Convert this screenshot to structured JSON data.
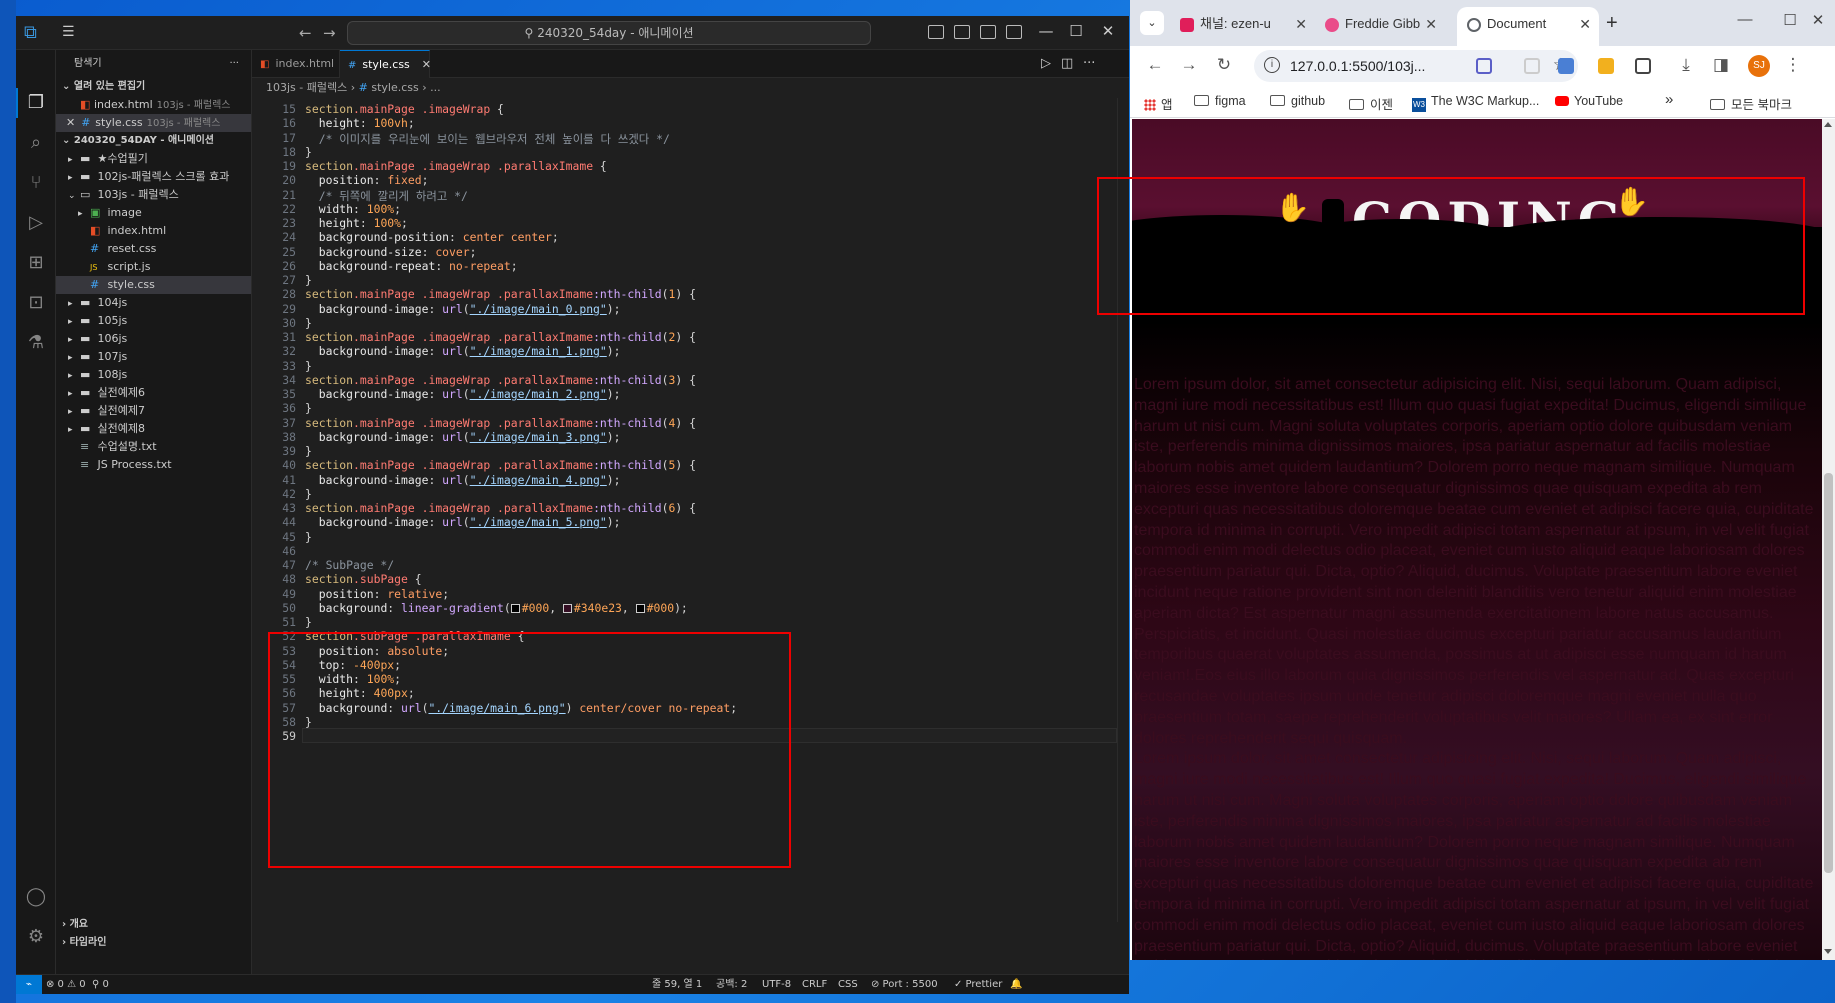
{
  "vscode": {
    "search_text": "240320_54day - 애니메이션",
    "sidebar": {
      "header": "탐색기",
      "open_editors_label": "열려 있는 편집기",
      "open_editors": [
        {
          "name": "index.html",
          "path": "103js - 패럴렉스"
        },
        {
          "name": "style.css",
          "path": "103js - 패럴렉스"
        }
      ],
      "workspace_label": "240320_54DAY - 애니메이션",
      "tree": [
        {
          "label": "★수업필기",
          "type": "folder",
          "depth": 1
        },
        {
          "label": "102js-패럴렉스 스크롤 효과",
          "type": "folder",
          "depth": 1
        },
        {
          "label": "103js - 패럴렉스",
          "type": "folder-open",
          "depth": 1
        },
        {
          "label": "image",
          "type": "img-folder",
          "depth": 2
        },
        {
          "label": "index.html",
          "type": "html",
          "depth": 2
        },
        {
          "label": "reset.css",
          "type": "css",
          "depth": 2
        },
        {
          "label": "script.js",
          "type": "js",
          "depth": 2
        },
        {
          "label": "style.css",
          "type": "css",
          "depth": 2
        },
        {
          "label": "104js",
          "type": "folder",
          "depth": 1
        },
        {
          "label": "105js",
          "type": "folder",
          "depth": 1
        },
        {
          "label": "106js",
          "type": "folder",
          "depth": 1
        },
        {
          "label": "107js",
          "type": "folder",
          "depth": 1
        },
        {
          "label": "108js",
          "type": "folder",
          "depth": 1
        },
        {
          "label": "실전예제6",
          "type": "folder",
          "depth": 1
        },
        {
          "label": "실전예제7",
          "type": "folder",
          "depth": 1
        },
        {
          "label": "실전예제8",
          "type": "folder",
          "depth": 1
        },
        {
          "label": "수업설명.txt",
          "type": "txt",
          "depth": 1
        },
        {
          "label": "JS Process.txt",
          "type": "txt",
          "depth": 1
        }
      ],
      "outline_label": "개요",
      "timeline_label": "타임라인"
    },
    "tabs": [
      {
        "label": "index.html",
        "icon": "html-icon"
      },
      {
        "label": "style.css",
        "icon": "css-icon"
      }
    ],
    "breadcrumb": [
      "103js - 패럴렉스",
      "style.css",
      "..."
    ],
    "code_lines": [
      {
        "n": "15",
        "html": "<span class='k-sel'>section</span><span class='k-tag'>.mainPage</span> <span class='k-tag'>.imageWrap</span> {"
      },
      {
        "n": "16",
        "html": "  <span class='k-prop'>height</span>: <span class='k-num'>100vh</span>;"
      },
      {
        "n": "17",
        "html": "  <span class='k-cmt'>/* 이미지를 우리눈에 보이는 웹브라우저 전체 높이를 다 쓰겠다 */</span>"
      },
      {
        "n": "18",
        "html": "}"
      },
      {
        "n": "19",
        "html": "<span class='k-sel'>section</span><span class='k-tag'>.mainPage</span> <span class='k-tag'>.imageWrap</span> <span class='k-tag'>.parallaxImame</span> {"
      },
      {
        "n": "20",
        "html": "  <span class='k-prop'>position</span>: <span class='k-val'>fixed</span>;"
      },
      {
        "n": "21",
        "html": "  <span class='k-cmt'>/* 뒤쪽에 깔리게 하려고 */</span>"
      },
      {
        "n": "22",
        "html": "  <span class='k-prop'>width</span>: <span class='k-num'>100%</span>;"
      },
      {
        "n": "23",
        "html": "  <span class='k-prop'>height</span>: <span class='k-num'>100%</span>;"
      },
      {
        "n": "24",
        "html": "  <span class='k-prop'>background-position</span>: <span class='k-val'>center center</span>;"
      },
      {
        "n": "25",
        "html": "  <span class='k-prop'>background-size</span>: <span class='k-val'>cover</span>;"
      },
      {
        "n": "26",
        "html": "  <span class='k-prop'>background-repeat</span>: <span class='k-val'>no-repeat</span>;"
      },
      {
        "n": "27",
        "html": "}"
      },
      {
        "n": "28",
        "html": "<span class='k-sel'>section</span><span class='k-tag'>.mainPage</span> <span class='k-tag'>.imageWrap</span> <span class='k-tag'>.parallaxImame</span><span class='k-fn'>:nth-child</span>(<span class='k-num'>1</span>) {"
      },
      {
        "n": "29",
        "html": "  <span class='k-prop'>background-image</span>: <span class='k-fn'>url</span>(<span class='k-str'>\"./image/main_0.png\"</span>);"
      },
      {
        "n": "30",
        "html": "}"
      },
      {
        "n": "31",
        "html": "<span class='k-sel'>section</span><span class='k-tag'>.mainPage</span> <span class='k-tag'>.imageWrap</span> <span class='k-tag'>.parallaxImame</span><span class='k-fn'>:nth-child</span>(<span class='k-num'>2</span>) {"
      },
      {
        "n": "32",
        "html": "  <span class='k-prop'>background-image</span>: <span class='k-fn'>url</span>(<span class='k-str'>\"./image/main_1.png\"</span>);"
      },
      {
        "n": "33",
        "html": "}"
      },
      {
        "n": "34",
        "html": "<span class='k-sel'>section</span><span class='k-tag'>.mainPage</span> <span class='k-tag'>.imageWrap</span> <span class='k-tag'>.parallaxImame</span><span class='k-fn'>:nth-child</span>(<span class='k-num'>3</span>) {"
      },
      {
        "n": "35",
        "html": "  <span class='k-prop'>background-image</span>: <span class='k-fn'>url</span>(<span class='k-str'>\"./image/main_2.png\"</span>);"
      },
      {
        "n": "36",
        "html": "}"
      },
      {
        "n": "37",
        "html": "<span class='k-sel'>section</span><span class='k-tag'>.mainPage</span> <span class='k-tag'>.imageWrap</span> <span class='k-tag'>.parallaxImame</span><span class='k-fn'>:nth-child</span>(<span class='k-num'>4</span>) {"
      },
      {
        "n": "38",
        "html": "  <span class='k-prop'>background-image</span>: <span class='k-fn'>url</span>(<span class='k-str'>\"./image/main_3.png\"</span>);"
      },
      {
        "n": "39",
        "html": "}"
      },
      {
        "n": "40",
        "html": "<span class='k-sel'>section</span><span class='k-tag'>.mainPage</span> <span class='k-tag'>.imageWrap</span> <span class='k-tag'>.parallaxImame</span><span class='k-fn'>:nth-child</span>(<span class='k-num'>5</span>) {"
      },
      {
        "n": "41",
        "html": "  <span class='k-prop'>background-image</span>: <span class='k-fn'>url</span>(<span class='k-str'>\"./image/main_4.png\"</span>);"
      },
      {
        "n": "42",
        "html": "}"
      },
      {
        "n": "43",
        "html": "<span class='k-sel'>section</span><span class='k-tag'>.mainPage</span> <span class='k-tag'>.imageWrap</span> <span class='k-tag'>.parallaxImame</span><span class='k-fn'>:nth-child</span>(<span class='k-num'>6</span>) {"
      },
      {
        "n": "44",
        "html": "  <span class='k-prop'>background-image</span>: <span class='k-fn'>url</span>(<span class='k-str'>\"./image/main_5.png\"</span>);"
      },
      {
        "n": "45",
        "html": "}"
      },
      {
        "n": "46",
        "html": ""
      },
      {
        "n": "47",
        "html": "<span class='k-cmt'>/* SubPage */</span>"
      },
      {
        "n": "48",
        "html": "<span class='k-sel'>section</span><span class='k-tag'>.subPage</span> {"
      },
      {
        "n": "49",
        "html": "  <span class='k-prop'>position</span>: <span class='k-val'>relative</span>;"
      },
      {
        "n": "50",
        "html": "  <span class='k-prop'>background</span>: <span class='k-fn'>linear-gradient</span>(<span class='sw' style='background:#000'></span><span class='k-col'>#000</span>, <span class='sw' style='background:#340e23'></span><span class='k-col'>#340e23</span>, <span class='sw' style='background:#000'></span><span class='k-col'>#000</span>);"
      },
      {
        "n": "51",
        "html": "}"
      },
      {
        "n": "52",
        "html": "<span class='k-sel'>section</span><span class='k-tag'>.subPage</span> <span class='k-tag'>.parallaxImame</span> {"
      },
      {
        "n": "53",
        "html": "  <span class='k-prop'>position</span>: <span class='k-val'>absolute</span>;"
      },
      {
        "n": "54",
        "html": "  <span class='k-prop'>top</span>: <span class='k-num'>-400px</span>;"
      },
      {
        "n": "55",
        "html": "  <span class='k-prop'>width</span>: <span class='k-num'>100%</span>;"
      },
      {
        "n": "56",
        "html": "  <span class='k-prop'>height</span>: <span class='k-num'>400px</span>;"
      },
      {
        "n": "57",
        "html": "  <span class='k-prop'>background</span>: <span class='k-fn'>url</span>(<span class='k-str'>\"./image/main_6.png\"</span>) <span class='k-val'>center/cover no-repeat</span>;"
      },
      {
        "n": "58",
        "html": "}"
      },
      {
        "n": "59",
        "html": ""
      }
    ],
    "status": {
      "errors": "⊗ 0 ⚠ 0",
      "ports": "⚲ 0",
      "position": "줄 59, 열 1",
      "spaces": "공백: 2",
      "encoding": "UTF-8",
      "eol": "CRLF",
      "language": "CSS",
      "port": "⊘ Port : 5500",
      "prettier": "✓ Prettier"
    }
  },
  "chrome": {
    "tabs": [
      {
        "label": "채널: ezen-u",
        "favicon_color": "#e01e5a"
      },
      {
        "label": "Freddie Gibb",
        "favicon_color": "#ea4c89"
      },
      {
        "label": "Document",
        "favicon_color": "#5f6368"
      }
    ],
    "url": "127.0.0.1:5500/103j...",
    "bookmarks": [
      {
        "label": "앱",
        "icon": "apps"
      },
      {
        "label": "figma",
        "icon": "folder"
      },
      {
        "label": "github",
        "icon": "folder"
      },
      {
        "label": "이젠",
        "icon": "folder"
      },
      {
        "label": "The W3C Markup...",
        "icon": "w3c"
      },
      {
        "label": "YouTube",
        "icon": "youtube"
      },
      {
        "label": "»",
        "icon": "none"
      },
      {
        "label": "모든 북마크",
        "icon": "folder"
      }
    ],
    "banner_text": "CODING",
    "profile_initials": "SJ",
    "lorem_paragraphs": [
      "Lorem ipsum dolor, sit amet consectetur adipisicing elit. Nisi, sequi laborum. Quam adipisci, magni iure modi necessitatibus est! Illum quo quasi fugiat expedita! Ducimus, eligendi similique harum ut nisi cum. Magni soluta voluptates corporis, aperiam optio dolore quibusdam veniam iste, perferendis minima dignissimos maiores, ipsa pariatur aspernatur ad facilis molestiae laborum nobis amet quidem laudantium? Dolorem porro neque magnam similique. Numquam maiores esse inventore labore consequatur dignissimos quae quisquam expedita ab rem excepturi quas necessitatibus doloremque beatae cum eveniet et adipisci facere quia, cupiditate tempora id minima in corrupti. Vero impedit adipisci totam aspernatur at ipsum, in vel velit fugiat commodi enim modi delectus odio placeat, eveniet cum iusto aliquid eaque laboriosam dolores praesentium pariatur qui. Dicta, optio? Aliquid, ducimus. Voluptate praesentium labore eveniet incidunt neque ratione provident sint non deleniti blanditiis vero tenetur aliquid enim molestiae aperiam dicta? Est aspernatur magni assumenda exercitationem labore natus accusamus. Perspiciatis, et incidunt. Quasi molestiae ducimus excepturi pariatur accusamus laudantium temporibus quaerat voluptates assumenda, possimus at ut adipisci esse numquam id harum veniam!.Eos eius illo laborum quia dignissimos perferendis vel aspernatur ad. Quas excepturi recusandae voluptates ipsum unde tenetur adipisci doloremque magni eveniet nulla quo praesentium totam, saepe reprehenderit voluptatibus velit maiores? Ullam ea, ex sint error dolores reprehenderit sequi quisquam.",
      "Lorem ipsum dolor, sit amet consectetur adipisicing elit. Nisi, sequi laborum. Quam adipisci, magni iure modi necessitatibus est! Illum quo quasi fugiat expedita! Ducimus, eligendi similique harum ut nisi cum. Magni soluta voluptates corporis, aperiam optio dolore quibusdam veniam iste, perferendis minima dignissimos maiores, ipsa pariatur aspernatur ad facilis molestiae laborum nobis amet quidem laudantium? Dolorem porro neque magnam similique. Numquam maiores esse inventore labore consequatur dignissimos quae quisquam expedita ab rem excepturi quas necessitatibus doloremque beatae cum eveniet et adipisci facere quia, cupiditate tempora id minima in corrupti. Vero impedit adipisci totam aspernatur at ipsum, in vel velit fugiat commodi enim modi delectus odio placeat, eveniet cum iusto aliquid eaque laboriosam dolores praesentium pariatur qui. Dicta, optio? Aliquid, ducimus. Voluptate praesentium labore eveniet incidunt neque ratione provident sint non deleniti blanditiis vero tenetur aliquid enim molestiae"
    ]
  },
  "colors": {
    "accent": "#0078d4",
    "highlight_box": "#e00000",
    "subpage_mid": "#340e23"
  }
}
